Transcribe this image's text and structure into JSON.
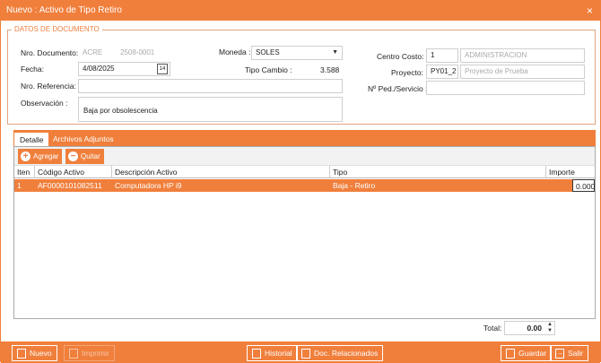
{
  "window": {
    "title": "Nuevo : Activo de Tipo Retiro",
    "close_glyph": "×"
  },
  "section": {
    "legend": "DATOS DE DOCUMENTO"
  },
  "form": {
    "nro_documento": {
      "label": "Nro. Documento:",
      "prefix": "ACRE",
      "number": "2508-0001"
    },
    "fecha": {
      "label": "Fecha:",
      "value": "4/08/2025"
    },
    "nro_referencia": {
      "label": "Nro. Referencia:",
      "value": ""
    },
    "observacion": {
      "label": "Observación :",
      "value": "Baja por obsolescencia"
    },
    "moneda": {
      "label": "Moneda :",
      "value": "SOLES"
    },
    "tipo_cambio": {
      "label": "Tipo Cambio :",
      "value": "3.588"
    },
    "centro_costo": {
      "label": "Centro Costo:",
      "code": "1",
      "name": "ADMINISTRACION"
    },
    "proyecto": {
      "label": "Proyecto:",
      "code": "PY01_2",
      "name": "Proyecto de Prueba"
    },
    "pedido_servicio": {
      "label": "Nº Ped./Servicio :",
      "value": ""
    }
  },
  "tabs": [
    {
      "label": "Detalle"
    },
    {
      "label": "Archivos Adjuntos"
    }
  ],
  "grid_toolbar": {
    "add_label": "Agregar",
    "remove_label": "Quitar"
  },
  "grid": {
    "columns": [
      "Iten",
      "Código Activo",
      "Descripción Activo",
      "Tipo",
      "Importe"
    ],
    "rows": [
      {
        "item": "1",
        "codigo": "AF0000101082511",
        "descripcion": "Computadora HP i9",
        "tipo": "Baja -  Retiro",
        "importe": "0.000"
      }
    ]
  },
  "total": {
    "label": "Total:",
    "value": "0.00"
  },
  "buttons": {
    "nuevo": "Nuevo",
    "imprimir": "Imprimir",
    "historial": "Historial",
    "doc_relacionados": "Doc. Relacionados",
    "guardar": "Guardar",
    "salir": "Salir"
  },
  "colors": {
    "accent": "#f07f3c"
  }
}
